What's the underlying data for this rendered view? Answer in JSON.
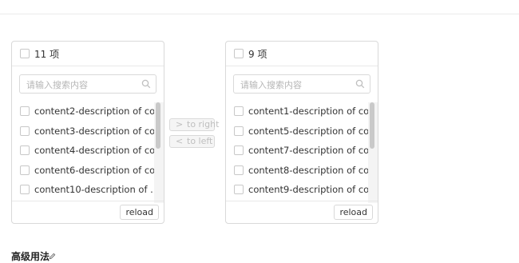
{
  "left_panel": {
    "count": "11 项",
    "search_placeholder": "请输入搜索内容",
    "items": [
      "content2-description of co...",
      "content3-description of co...",
      "content4-description of co...",
      "content6-description of co...",
      "content10-description of ..."
    ],
    "reload_label": "reload"
  },
  "right_panel": {
    "count": "9 项",
    "search_placeholder": "请输入搜索内容",
    "items": [
      "content1-description of co...",
      "content5-description of co...",
      "content7-description of co...",
      "content8-description of co...",
      "content9-description of co..."
    ],
    "reload_label": "reload"
  },
  "operations": {
    "to_right_label": "to right",
    "to_right_arrow": ">",
    "to_left_label": "to left",
    "to_left_arrow": "<"
  },
  "section": {
    "title": "高级用法"
  },
  "colors": {
    "border": "#d9d9d9",
    "disabled_text": "#bfbfbf",
    "disabled_bg": "#f5f5f5"
  },
  "icons": {
    "search": "search-icon",
    "edit": "edit-icon"
  }
}
